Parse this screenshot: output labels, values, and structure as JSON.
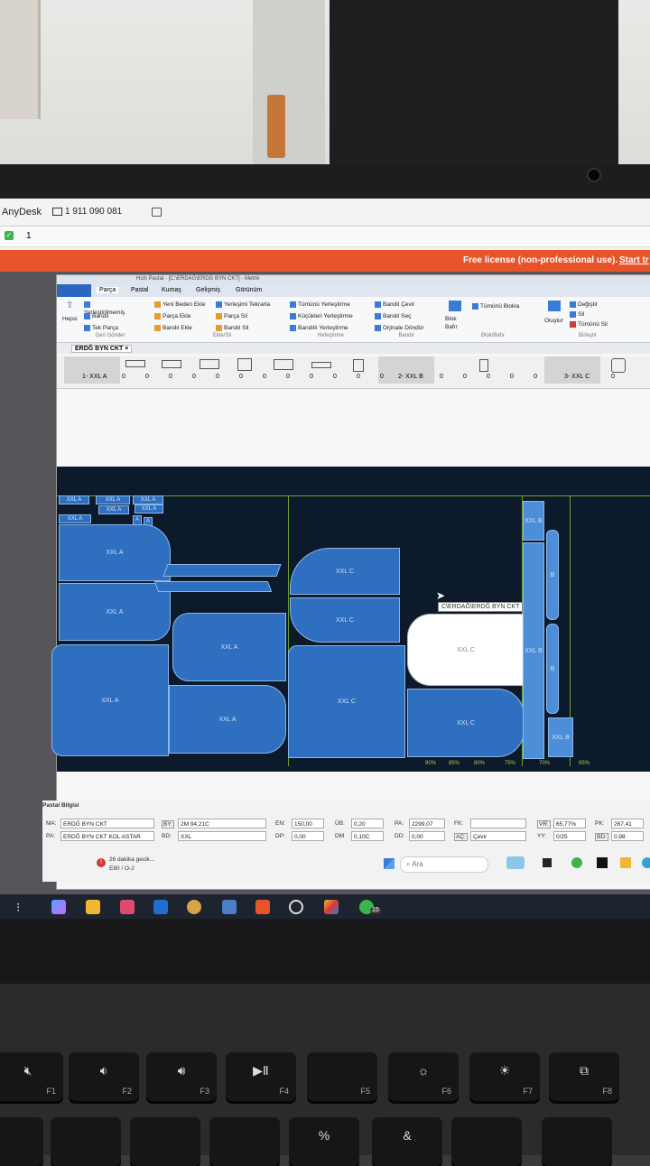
{
  "anydesk": {
    "app_name": "AnyDesk",
    "address": "1 911 090 081",
    "tab_number": "1",
    "license_text": "Free license (non-professional use).",
    "license_link": "Start tr"
  },
  "app": {
    "title": "Hızlı Pastal - [C:\\ERDAĞ\\ERDĞ BYN CKT] - Metrik",
    "menu_tabs": [
      "Parça",
      "Pastal",
      "Kumaş",
      "Gelişmiş",
      "Görünüm"
    ],
    "ribbon": {
      "hepsi": "Hepsi",
      "gen_group": [
        "Yerleştirilmemiş",
        "Bandıl",
        "Tek Parça"
      ],
      "gen_label": "Geri Gönder",
      "ekle_col1": [
        "Yeni Beden Ekle",
        "Parça Ekle",
        "Bandıl Ekle"
      ],
      "ekle_col2": [
        "Yerleşimi Tekrarla",
        "Parça Sil",
        "Bandıl Sil"
      ],
      "ekle_label": "Ekle/Sil",
      "yer_group": [
        "Tümünü Yerleştirme",
        "Küçükleri Yerleştirme",
        "Bandıllı Yerleştirme"
      ],
      "yer_label": "Yerleştirme",
      "bandil_group": [
        "Bandıl Çevir",
        "Bandıl Seç",
        "Orjinale Döndür"
      ],
      "bandil_label": "Bandıl",
      "blok_btn": "Blok Bafır",
      "blok_all": "Tümünü Blokla",
      "blok_label": "Blok/Bafır",
      "olustur": "Oluştur",
      "birlestir_group": [
        "Değiştir",
        "Sil",
        "Tümünü Sil"
      ],
      "birlestir_label": "Birleştir"
    },
    "doc_tab": "ERDĞ BYN CKT",
    "piece_strip": {
      "group1": "1- XXL A",
      "group2": "2- XXL B",
      "group3": "3- XXL C",
      "counts": [
        "0",
        "0",
        "0",
        "0",
        "0",
        "0",
        "0",
        "0",
        "0",
        "0",
        "0",
        "0",
        "0",
        "0",
        "0",
        "0",
        "0",
        "0"
      ]
    },
    "marker": {
      "labels_a": [
        "XXL A",
        "XXL A",
        "XXL A",
        "XXL A",
        "XXL A",
        "XXL A"
      ],
      "tiny": [
        "A",
        "A"
      ],
      "big_a": [
        "XXL A",
        "XXL A",
        "XXL A",
        "XXL A",
        "XXL A"
      ],
      "c_labels": [
        "XXL C",
        "XXL C",
        "XXL C",
        "XXL C",
        "XXL C"
      ],
      "b_labels": [
        "XXL B",
        "XXL B",
        "XXL B"
      ],
      "b_letters": [
        "B",
        "B"
      ],
      "tooltip": "C\\ERDAĞ\\ERDĞ BYN CKT",
      "percent_marks": [
        "90%",
        "85%",
        "80%",
        "75%",
        "70%",
        "65%"
      ]
    },
    "info": {
      "title": "Pastal Bilgisi",
      "ma_label": "MA:",
      "ma_value": "ERDĞ BYN CKT",
      "pa_label": "PA:",
      "pa_value": "ERDĞ BYN CKT KOL ASTAR",
      "by_label": "BY:",
      "by_value": "2M 94,21C",
      "bd_label": "BD:",
      "bd_value": "XXL",
      "en_label": "EN:",
      "en_value": "150,00",
      "dp_label": "DP:",
      "dp_value": "0,00",
      "ub_label": "ÜB:",
      "ub_value": "0,20",
      "dm_label": "DM",
      "dm_value": "0,10C",
      "pa2_label": "PA:",
      "pa2_value": "2299,07",
      "dd_label": "DD:",
      "dd_value": "0,00",
      "fk_label": "FK:",
      "fk_value": "",
      "ac_label": "AÇ:",
      "ac_value": "Çevir",
      "vr_label": "VR:",
      "vr_value": "65,77%",
      "yy_label": "YY:",
      "yy_value": "0/25",
      "pk_label": "PK:",
      "pk_value": "267,41",
      "bd2_label": "BD:",
      "bd2_value": "0,98"
    }
  },
  "taskbar": {
    "notice_title": "26 dakika gecik...",
    "notice_sub": "E80 / O-2",
    "search_placeholder": "Ara",
    "whatsapp_badge": "15"
  },
  "keyboard": {
    "fkeys": [
      "F1",
      "F2",
      "F3",
      "F4",
      "F5",
      "F6",
      "F7",
      "F8"
    ],
    "row2": [
      "%",
      "&"
    ]
  },
  "colors": {
    "license_bar": "#e8542a",
    "piece_blue": "#2e6fbf",
    "marker_bg": "#0c1a2c"
  }
}
